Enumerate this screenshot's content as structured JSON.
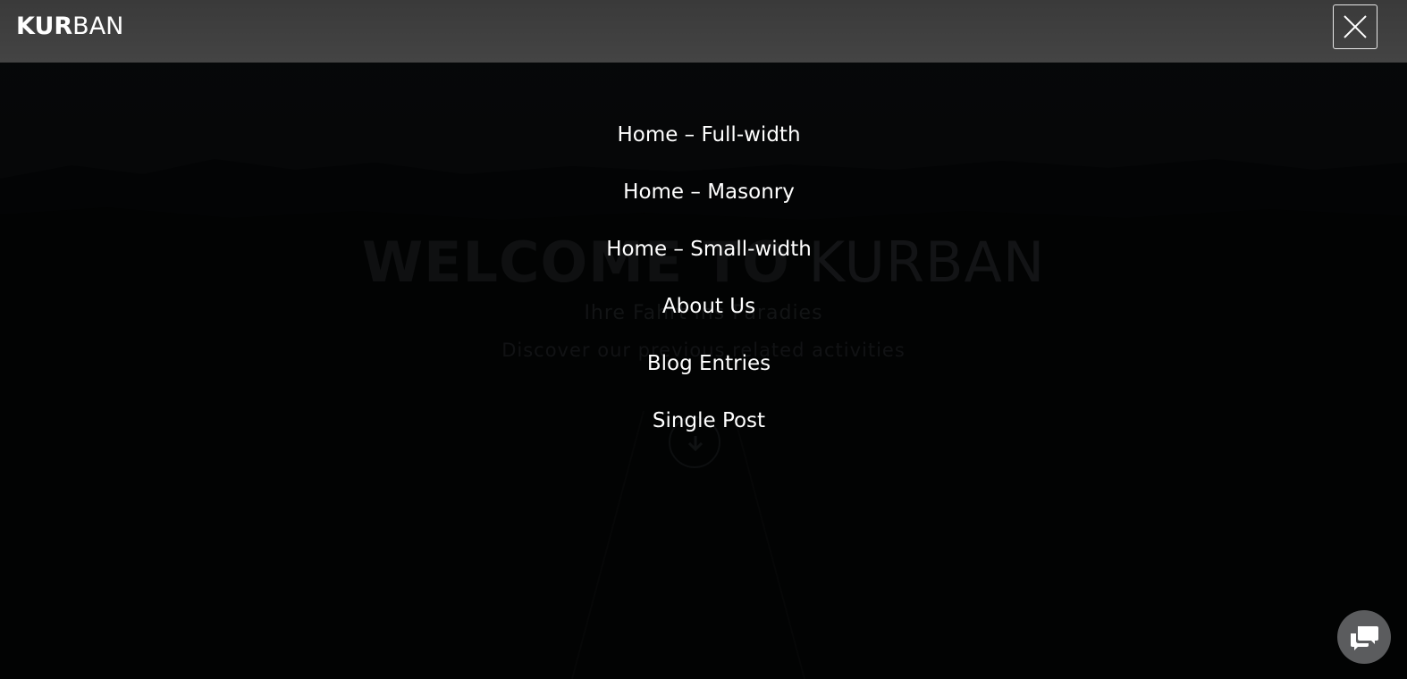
{
  "header": {
    "logo_bold": "KUR",
    "logo_light": "BAN"
  },
  "menu": {
    "items": [
      {
        "label": "Home – Full-width"
      },
      {
        "label": "Home – Masonry"
      },
      {
        "label": "Home – Small-width"
      },
      {
        "label": "About Us"
      },
      {
        "label": "Blog Entries"
      },
      {
        "label": "Single Post"
      }
    ]
  },
  "hero": {
    "title_bold": "WELCOME TO",
    "title_light": "KURBAN",
    "subtitle": "Ihre Fahrt ins Paradies",
    "tagline": "Discover our previous related activities"
  },
  "icons": {
    "close": "close-icon",
    "chat": "chat-bubbles-icon",
    "scroll_down": "arrow-down-icon"
  },
  "colors": {
    "topbar": "#3f3f3f",
    "overlay": "#000000",
    "text": "#ffffff",
    "chat_button": "#5b5c5e"
  }
}
